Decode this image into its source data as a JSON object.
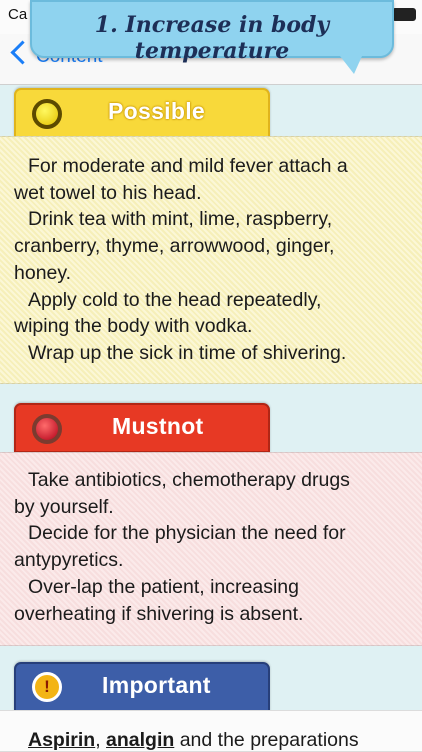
{
  "status_bar": {
    "carrier": "Ca"
  },
  "nav": {
    "back_label": "Content"
  },
  "title": "1. Increase in body temperature",
  "possible": {
    "label": "Possible",
    "items": [
      "For moderate and mild fever attach a",
      "wet towel to his head.",
      "Drink tea with mint, lime, raspberry,",
      "cranberry, thyme, arrowwood, ginger,",
      "honey.",
      "Apply cold to the head repeatedly,",
      "wiping the body with vodka.",
      "Wrap up the sick in time of shivering."
    ]
  },
  "mustnot": {
    "label": "Mustnot",
    "items": [
      "Take antibiotics, chemotherapy drugs",
      "by yourself.",
      "Decide for the physician the need for",
      "antypyretics.",
      "Over-lap the patient, increasing",
      "overheating if shivering is absent."
    ]
  },
  "important": {
    "label": "Important",
    "icon_glyph": "!",
    "text_bold_1": "Aspirin",
    "text_sep": ", ",
    "text_bold_2": "analgin",
    "text_rest": " and the preparations"
  },
  "colors": {
    "accent": "#1a7ef7",
    "possible": "#f8d93a",
    "mustnot": "#e73924",
    "important": "#3d5ea8"
  }
}
